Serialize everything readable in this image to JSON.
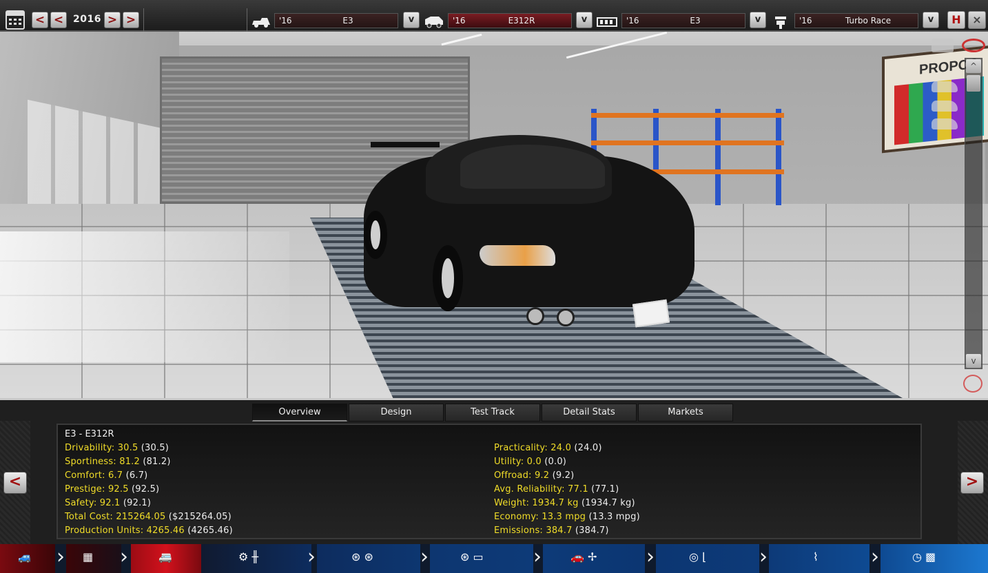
{
  "topbar": {
    "year": "2016",
    "prev_decade": "<",
    "prev_year": "<",
    "next_year": ">",
    "next_decade": ">",
    "model": {
      "year": "'16",
      "name": "E3"
    },
    "trim": {
      "year": "'16",
      "name": "E312R"
    },
    "engine_family": {
      "year": "'16",
      "name": "E3"
    },
    "engine_variant": {
      "year": "'16",
      "name": "Turbo Race"
    },
    "dropdown_glyph": "v",
    "save_label": "H",
    "close_label": "×"
  },
  "scene": {
    "poster_text": "PROPOS",
    "scroll_up": "^",
    "scroll_down": "v"
  },
  "tabs": [
    {
      "label": "Overview",
      "active": true
    },
    {
      "label": "Design",
      "active": false
    },
    {
      "label": "Test Track",
      "active": false
    },
    {
      "label": "Detail Stats",
      "active": false
    },
    {
      "label": "Markets",
      "active": false
    }
  ],
  "stats": {
    "heading": "E3 - E312R",
    "left": [
      {
        "key": "Drivability:",
        "value": "30.5",
        "paren": "(30.5)"
      },
      {
        "key": "Sportiness:",
        "value": "81.2",
        "paren": "(81.2)"
      },
      {
        "key": "Comfort:",
        "value": "6.7",
        "paren": "(6.7)"
      },
      {
        "key": "Prestige:",
        "value": "92.5",
        "paren": "(92.5)"
      },
      {
        "key": "Safety:",
        "value": "92.1",
        "paren": "(92.1)"
      },
      {
        "key": "Total Cost:",
        "value": "215264.05",
        "paren": "($215264.05)"
      },
      {
        "key": "Production Units:",
        "value": "4265.46",
        "paren": "(4265.46)"
      }
    ],
    "right": [
      {
        "key": "Practicality:",
        "value": "24.0",
        "paren": "(24.0)"
      },
      {
        "key": "Utility:",
        "value": "0.0",
        "paren": "(0.0)"
      },
      {
        "key": "Offroad:",
        "value": "9.2",
        "paren": "(9.2)"
      },
      {
        "key": "Avg. Reliability:",
        "value": "77.1",
        "paren": "(77.1)"
      },
      {
        "key": "Weight:",
        "value": "1934.7 kg",
        "paren": "(1934.7 kg)"
      },
      {
        "key": "Economy:",
        "value": "13.3 mpg",
        "paren": "(13.3 mpg)"
      },
      {
        "key": "Emissions:",
        "value": "384.7",
        "paren": "(384.7)"
      }
    ],
    "prev_label": "<",
    "next_label": ">"
  },
  "bottom_nav": [
    {
      "icon": "car-model-icon",
      "glyph": "🚙"
    },
    {
      "icon": "chassis-icon",
      "glyph": "▦"
    },
    {
      "icon": "car-trim-icon",
      "glyph": "🚐",
      "active": true
    },
    {
      "icon": "engine-gearbox-icon",
      "glyph": "⚙ ╫"
    },
    {
      "icon": "wheels-icon",
      "glyph": "⊛ ⊛"
    },
    {
      "icon": "brakes-icon",
      "glyph": "⊛ ▭"
    },
    {
      "icon": "body-aero-icon",
      "glyph": "🚗 ✢"
    },
    {
      "icon": "interior-icon",
      "glyph": "◎ ⌊"
    },
    {
      "icon": "suspension-icon",
      "glyph": "⌇"
    },
    {
      "icon": "test-finish-icon",
      "glyph": "◷ ▩"
    }
  ],
  "colors": {
    "stat_yellow": "#f0dc28",
    "active_trim": "#7a1c22",
    "accent_red": "#a01010"
  }
}
